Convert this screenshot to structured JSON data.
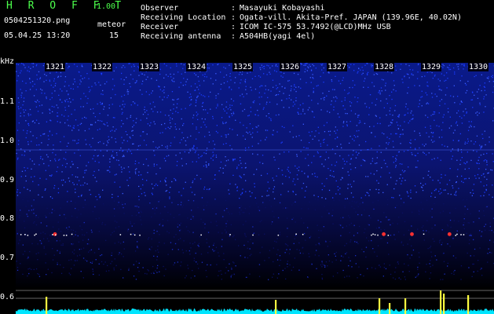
{
  "header": {
    "app_title": "H R O F F T",
    "app_version": "1.00",
    "filename": "0504251320.png",
    "datetime": "05.04.25 13:20",
    "meteor_label": "meteor",
    "meteor_count": "15"
  },
  "info": [
    {
      "label": "Observer",
      "value": "Masayuki Kobayashi"
    },
    {
      "label": "Receiving Location",
      "value": "Ogata-vill. Akita-Pref. JAPAN (139.96E, 40.02N)"
    },
    {
      "label": "Receiver",
      "value": "ICOM IC-575 53.7492(@LCD)MHz USB"
    },
    {
      "label": "Receiving antenna",
      "value": "A504HB(yagi 4el)"
    }
  ],
  "colon": ":",
  "axis": {
    "unit": "kHz",
    "freq_labels": [
      "1.1",
      "1.0",
      "0.9",
      "0.8",
      "0.7",
      "0.6"
    ],
    "time_labels": [
      "1321",
      "1322",
      "1323",
      "1324",
      "1325",
      "1326",
      "1327",
      "1328",
      "1329",
      "1330"
    ]
  },
  "colors": {
    "background": "#000000",
    "noise_high": "#1a3cff",
    "noise_low": "#0a1060",
    "meteor": "#ff3030",
    "level_base": "#00e5ff",
    "level_spike": "#ffff40"
  },
  "chart_data": {
    "type": "heatmap",
    "xlabel": "",
    "ylabel": "kHz",
    "x_ticks": [
      "1321",
      "1322",
      "1323",
      "1324",
      "1325",
      "1326",
      "1327",
      "1328",
      "1329",
      "1330"
    ],
    "y_ticks": [
      1.1,
      1.0,
      0.9,
      0.8,
      0.7,
      0.6
    ],
    "meteor_echoes": [
      {
        "time": "1321.0",
        "freq_khz": 0.76
      },
      {
        "time": "1328.0",
        "freq_khz": 0.76
      },
      {
        "time": "1328.6",
        "freq_khz": 0.76
      },
      {
        "time": "1329.4",
        "freq_khz": 0.76
      }
    ]
  }
}
